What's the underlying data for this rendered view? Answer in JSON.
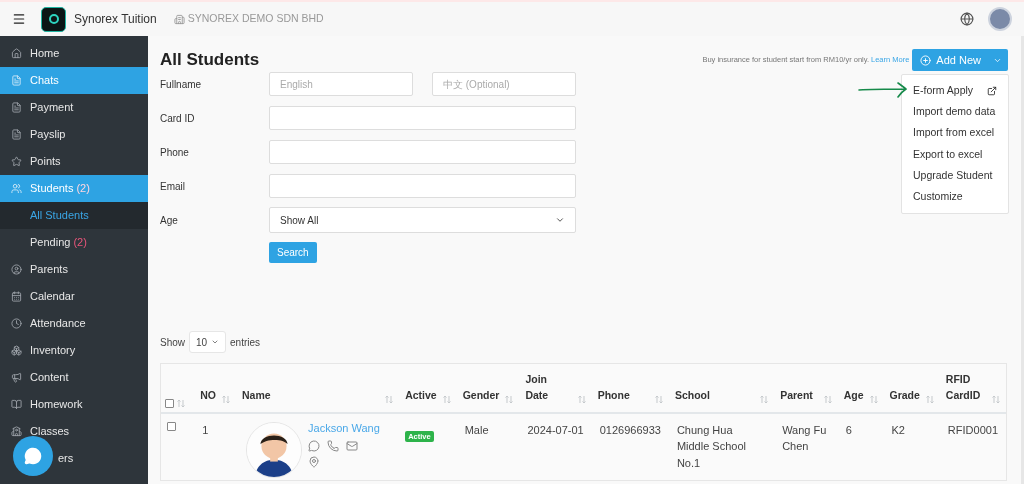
{
  "header": {
    "app_name": "Synorex Tuition",
    "company": "SYNOREX DEMO SDN BHD"
  },
  "sidebar": {
    "items": [
      {
        "label": "Home",
        "selected": false
      },
      {
        "label": "Chats",
        "selected": true
      },
      {
        "label": "Payment",
        "selected": false
      },
      {
        "label": "Payslip",
        "selected": false
      },
      {
        "label": "Points",
        "selected": false
      },
      {
        "label": "Students",
        "count": "(2)",
        "selected": true,
        "children": [
          {
            "label": "All Students",
            "selected": true
          },
          {
            "label": "Pending",
            "count": "(2)",
            "selected": false
          }
        ]
      },
      {
        "label": "Parents",
        "selected": false
      },
      {
        "label": "Calendar",
        "selected": false
      },
      {
        "label": "Attendance",
        "selected": false
      },
      {
        "label": "Inventory",
        "selected": false
      },
      {
        "label": "Content",
        "selected": false
      },
      {
        "label": "Homework",
        "selected": false
      },
      {
        "label": "Classes",
        "selected": false
      },
      {
        "label": "ers",
        "selected": false
      }
    ]
  },
  "page": {
    "title": "All Students",
    "insurance_note": "Buy insurance for student start from RM10/yr only.",
    "insurance_link": "Learn More",
    "add_button": "Add New",
    "menu": [
      {
        "label": "E-form Apply",
        "external": true
      },
      {
        "label": "Import demo data",
        "external": false
      },
      {
        "label": "Import from excel",
        "external": false
      },
      {
        "label": "Export to excel",
        "external": false
      },
      {
        "label": "Upgrade Student",
        "external": false
      },
      {
        "label": "Customize",
        "external": false
      }
    ]
  },
  "filters": [
    {
      "label": "Fullname",
      "kind": "pair",
      "placeholder": "English",
      "placeholder_2": "中文 (Optional)"
    },
    {
      "label": "Card ID",
      "kind": "text"
    },
    {
      "label": "Phone",
      "kind": "text"
    },
    {
      "label": "Email",
      "kind": "text"
    },
    {
      "label": "Age",
      "kind": "select",
      "value": "Show All"
    }
  ],
  "search_button": "Search",
  "entries": {
    "before": "Show",
    "value": "10",
    "after": "entries"
  },
  "table": {
    "select_all": false,
    "columns": [
      "NO",
      "Name",
      "Active",
      "Gender",
      "Join Date",
      "Phone",
      "School",
      "Parent",
      "Age",
      "Grade",
      "RFID CardID"
    ],
    "rows": [
      {
        "checked": false,
        "no": "1",
        "name": "Jackson Wang",
        "status": "Active",
        "gender": "Male",
        "join_date": "2024-07-01",
        "phone": "0126966933",
        "school": "Chung Hua Middle School No.1",
        "parent": "Wang Fu Chen",
        "age": "6",
        "grade": "K2",
        "rfid": "RFID0001"
      }
    ]
  }
}
